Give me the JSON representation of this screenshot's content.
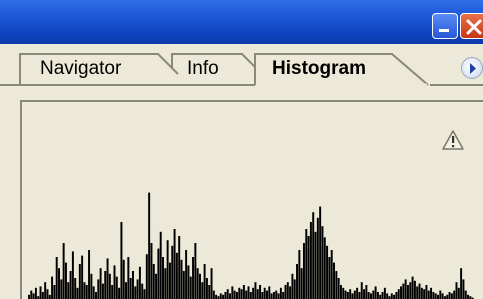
{
  "window": {
    "controls": [
      "minimize",
      "close"
    ]
  },
  "tabs": [
    {
      "label": "Navigator",
      "active": false
    },
    {
      "label": "Info",
      "active": false
    },
    {
      "label": "Histogram",
      "active": true
    }
  ],
  "panel_menu": {
    "icon": "flyout-arrow-icon"
  },
  "histogram": {
    "warning_icon": "warning-triangle-icon",
    "bar_color": "#000000",
    "background_color": "#ece9d8",
    "levels": [
      0.03,
      0.06,
      0.04,
      0.08,
      0.02,
      0.09,
      0.05,
      0.12,
      0.07,
      0.03,
      0.16,
      0.1,
      0.3,
      0.22,
      0.14,
      0.4,
      0.26,
      0.12,
      0.2,
      0.34,
      0.15,
      0.08,
      0.25,
      0.31,
      0.12,
      0.1,
      0.35,
      0.18,
      0.09,
      0.05,
      0.14,
      0.22,
      0.11,
      0.2,
      0.29,
      0.18,
      0.1,
      0.24,
      0.16,
      0.08,
      0.55,
      0.28,
      0.12,
      0.3,
      0.15,
      0.2,
      0.09,
      0.14,
      0.23,
      0.11,
      0.07,
      0.32,
      0.76,
      0.4,
      0.25,
      0.18,
      0.36,
      0.48,
      0.3,
      0.22,
      0.42,
      0.26,
      0.38,
      0.5,
      0.33,
      0.45,
      0.28,
      0.2,
      0.35,
      0.24,
      0.16,
      0.3,
      0.4,
      0.22,
      0.18,
      0.12,
      0.25,
      0.15,
      0.1,
      0.22,
      0.06,
      0.03,
      0.02,
      0.04,
      0.03,
      0.05,
      0.07,
      0.04,
      0.09,
      0.06,
      0.05,
      0.08,
      0.07,
      0.1,
      0.06,
      0.09,
      0.05,
      0.08,
      0.12,
      0.07,
      0.1,
      0.05,
      0.08,
      0.06,
      0.09,
      0.04,
      0.05,
      0.06,
      0.04,
      0.08,
      0.05,
      0.1,
      0.12,
      0.09,
      0.18,
      0.14,
      0.25,
      0.35,
      0.22,
      0.4,
      0.5,
      0.45,
      0.55,
      0.62,
      0.48,
      0.58,
      0.66,
      0.52,
      0.44,
      0.38,
      0.3,
      0.35,
      0.26,
      0.2,
      0.15,
      0.1,
      0.08,
      0.06,
      0.05,
      0.07,
      0.04,
      0.06,
      0.08,
      0.05,
      0.12,
      0.07,
      0.1,
      0.05,
      0.04,
      0.06,
      0.09,
      0.05,
      0.03,
      0.05,
      0.08,
      0.04,
      0.02,
      0.04,
      0.03,
      0.05,
      0.07,
      0.09,
      0.11,
      0.14,
      0.1,
      0.12,
      0.16,
      0.13,
      0.09,
      0.11,
      0.08,
      0.07,
      0.1,
      0.06,
      0.08,
      0.05,
      0.04,
      0.03,
      0.06,
      0.04,
      0.02,
      0.03,
      0.05,
      0.04,
      0.06,
      0.12,
      0.08,
      0.22,
      0.14,
      0.06,
      0.03,
      0.02,
      0.01
    ]
  }
}
